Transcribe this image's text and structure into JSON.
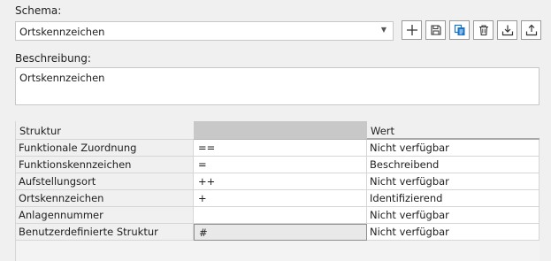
{
  "schema": {
    "label": "Schema:",
    "selected": "Ortskennzeichen"
  },
  "toolbar": [
    {
      "name": "add-button",
      "icon": "plus-icon"
    },
    {
      "name": "save-button",
      "icon": "save-icon"
    },
    {
      "name": "copy-button",
      "icon": "copy-icon"
    },
    {
      "name": "delete-button",
      "icon": "trash-icon"
    },
    {
      "name": "import-button",
      "icon": "import-icon"
    },
    {
      "name": "export-button",
      "icon": "export-icon"
    }
  ],
  "description": {
    "label": "Beschreibung:",
    "value": "Ortskennzeichen"
  },
  "table": {
    "headers": [
      "Struktur",
      "",
      "Wert"
    ],
    "rows": [
      {
        "struktur": "Funktionale Zuordnung",
        "zeichen": "==",
        "wert": "Nicht verfügbar"
      },
      {
        "struktur": "Funktionskennzeichen",
        "zeichen": "=",
        "wert": "Beschreibend"
      },
      {
        "struktur": "Aufstellungsort",
        "zeichen": "++",
        "wert": "Nicht verfügbar"
      },
      {
        "struktur": "Ortskennzeichen",
        "zeichen": "+",
        "wert": "Identifizierend"
      },
      {
        "struktur": "Anlagennummer",
        "zeichen": "",
        "wert": "Nicht verfügbar"
      },
      {
        "struktur": "Benutzerdefinierte Struktur",
        "zeichen": "#",
        "wert": "Nicht verfügbar"
      }
    ]
  },
  "colors": {
    "background": "#f0f0f0",
    "header_mid": "#c8c8c8",
    "accent_copy": "#1a73c9"
  }
}
